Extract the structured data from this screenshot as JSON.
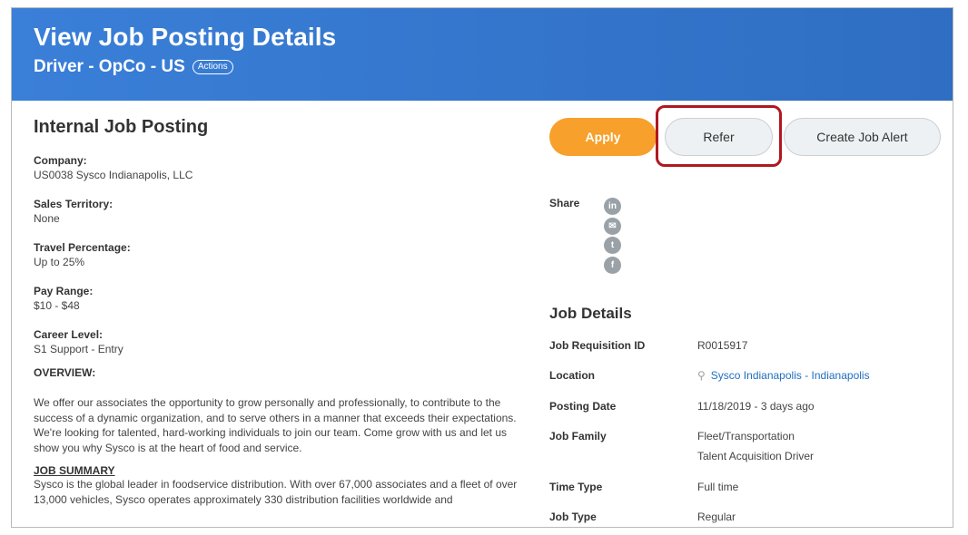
{
  "header": {
    "title": "View Job Posting Details",
    "subtitle": "Driver - OpCo - US",
    "actions_label": "Actions",
    "gradient_start": "#3a7fd8",
    "gradient_end": "#2f6ec2"
  },
  "posting": {
    "heading": "Internal Job Posting",
    "fields": [
      {
        "label": "Company:",
        "value": "US0038 Sysco Indianapolis, LLC"
      },
      {
        "label": "Sales Territory:",
        "value": "None"
      },
      {
        "label": "Travel Percentage:",
        "value": "Up to 25%"
      },
      {
        "label": "Pay Range:",
        "value": "$10 - $48"
      },
      {
        "label": "Career Level:",
        "value": "S1 Support - Entry"
      }
    ],
    "overview_label": "OVERVIEW:",
    "overview_text": "We offer our associates the opportunity to grow personally and professionally, to contribute to the success of a dynamic organization, and to serve others in a manner that exceeds their expectations. We're looking for talented, hard-working individuals to join our team. Come grow with us and let us show you why Sysco is at the heart of food and service.",
    "job_summary_label": "JOB SUMMARY",
    "job_summary_text": "Sysco is the global leader in foodservice distribution. With over 67,000 associates and a fleet of over 13,000 vehicles, Sysco operates approximately 330 distribution facilities worldwide and"
  },
  "buttons": {
    "apply": "Apply",
    "refer": "Refer",
    "create_alert": "Create Job Alert",
    "apply_color": "#f7a02b",
    "highlight_color": "#b01820"
  },
  "share": {
    "label": "Share",
    "icons": [
      {
        "name": "linkedin-icon",
        "glyph": "in"
      },
      {
        "name": "email-icon",
        "glyph": "✉"
      },
      {
        "name": "twitter-icon",
        "glyph": "t"
      },
      {
        "name": "facebook-icon",
        "glyph": "f"
      }
    ]
  },
  "job_details": {
    "heading": "Job Details",
    "rows": [
      {
        "label": "Job Requisition ID",
        "value": "R0015917"
      },
      {
        "label": "Location",
        "value": "Sysco Indianapolis - Indianapolis"
      },
      {
        "label": "Posting Date",
        "value": "11/18/2019 - 3 days ago"
      },
      {
        "label": "Job Family",
        "value": "Fleet/Transportation",
        "value2": "Talent Acquisition Driver"
      },
      {
        "label": "Time Type",
        "value": "Full time"
      },
      {
        "label": "Job Type",
        "value": "Regular"
      }
    ]
  }
}
